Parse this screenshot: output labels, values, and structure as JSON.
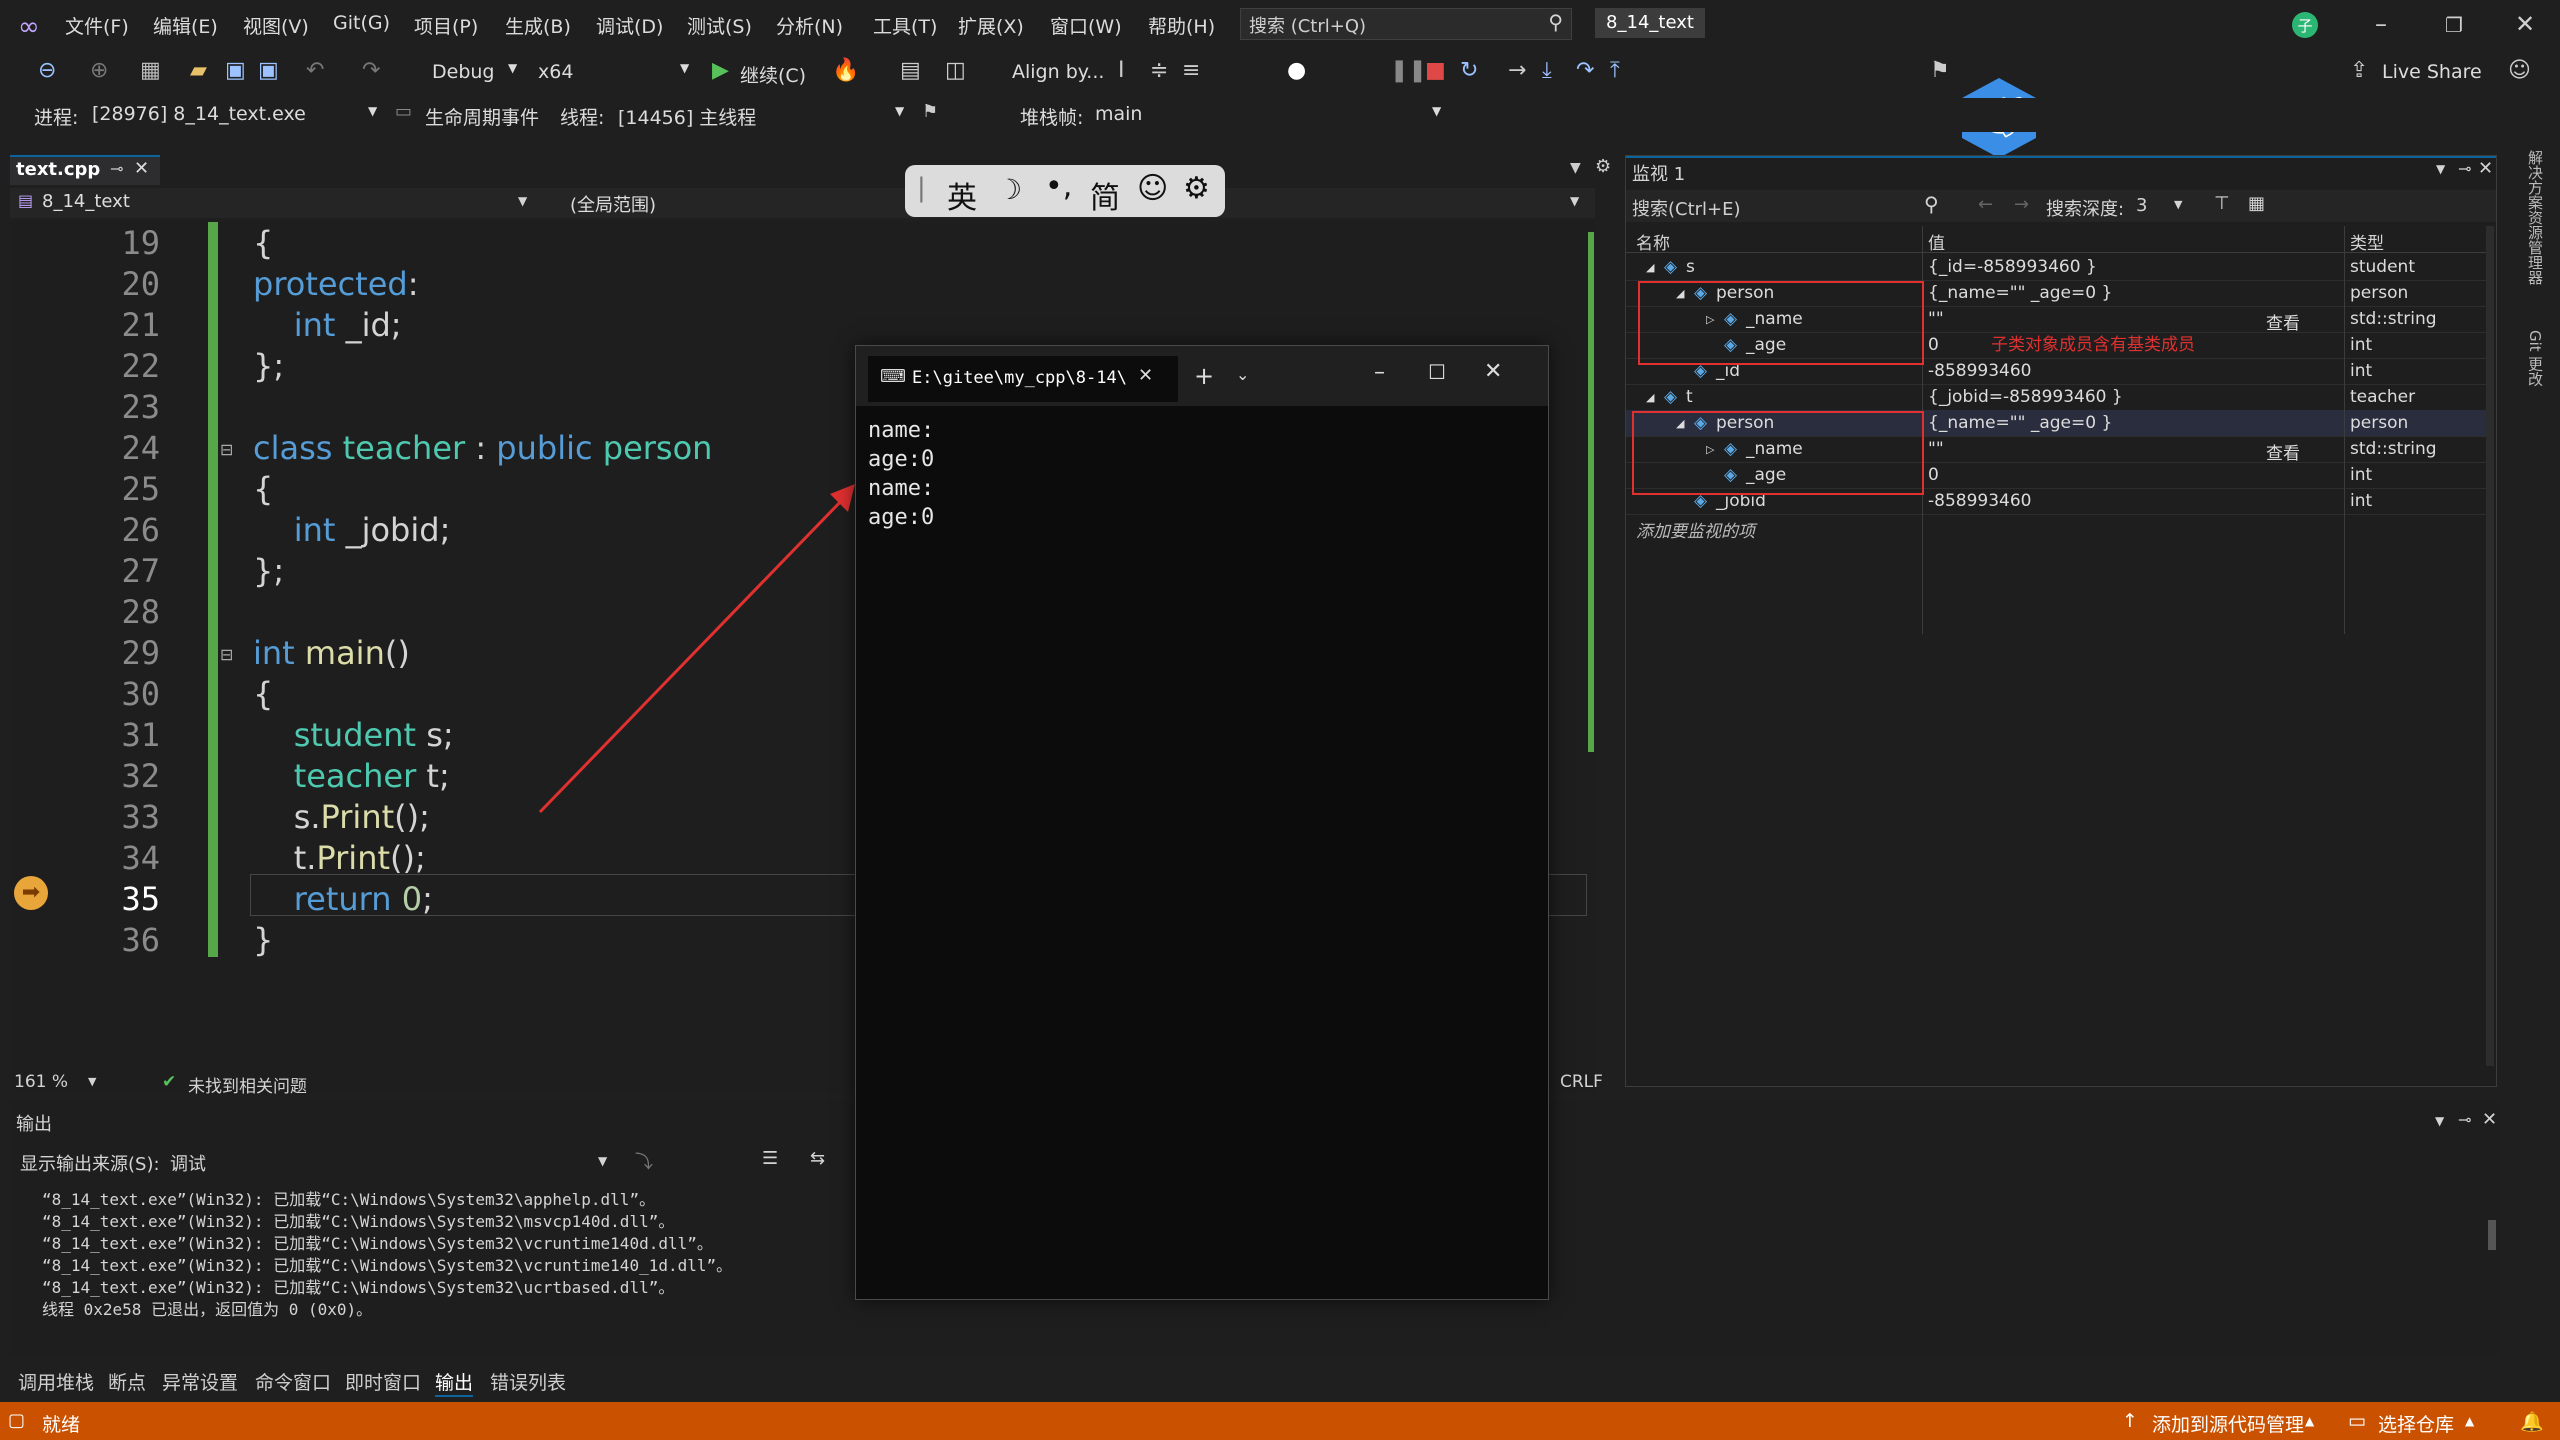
{
  "menu": {
    "items": [
      "文件(F)",
      "编辑(E)",
      "视图(V)",
      "Git(G)",
      "项目(P)",
      "生成(B)",
      "调试(D)",
      "测试(S)",
      "分析(N)",
      "工具(T)",
      "扩展(X)",
      "窗口(W)",
      "帮助(H)"
    ],
    "search_placeholder": "搜索 (Ctrl+Q)",
    "solution_name": "8_14_text",
    "user_initial": "子"
  },
  "toolbar": {
    "config": "Debug",
    "platform": "x64",
    "continue_label": "继续(C)",
    "align_label": "Align by...",
    "live_share": "Live Share",
    "process_label": "进程:",
    "process_value": "[28976] 8_14_text.exe",
    "lifecycle_label": "生命周期事件",
    "thread_label": "线程:",
    "thread_value": "[14456] 主线程",
    "stackframe_label": "堆栈帧:",
    "stackframe_value": "main"
  },
  "editor": {
    "tab_title": "text.cpp",
    "project_dropdown": "8_14_text",
    "scope_dropdown": "(全局范围)",
    "zoom": "161 %",
    "issues": "未找到相关问题",
    "line_ending": "CRLF",
    "current_line": "35",
    "line_numbers": [
      "19",
      "20",
      "21",
      "22",
      "23",
      "24",
      "25",
      "26",
      "27",
      "28",
      "29",
      "30",
      "31",
      "32",
      "33",
      "34",
      "35",
      "36"
    ]
  },
  "ime": {
    "lang": "英",
    "mode": "简"
  },
  "terminal": {
    "title": "E:\\gitee\\my_cpp\\8-14\\",
    "lines": [
      "name:",
      "age:0",
      "name:",
      "age:0"
    ]
  },
  "watch": {
    "title": "监视 1",
    "search_placeholder": "搜索(Ctrl+E)",
    "depth_label": "搜索深度:",
    "depth_value": "3",
    "headers": [
      "名称",
      "值",
      "类型"
    ],
    "add_item": "添加要监视的项",
    "annotation": "子类对象成员含有基类成员",
    "view_label": "查看",
    "rows": [
      {
        "name": "s",
        "value": "{_id=-858993460 }",
        "type": "student"
      },
      {
        "name": "person",
        "value": "{_name=\"\" _age=0 }",
        "type": "person"
      },
      {
        "name": "_name",
        "value": "\"\"",
        "type": "std::string"
      },
      {
        "name": "_age",
        "value": "0",
        "type": "int"
      },
      {
        "name": "_id",
        "value": "-858993460",
        "type": "int"
      },
      {
        "name": "t",
        "value": "{_jobid=-858993460 }",
        "type": "teacher"
      },
      {
        "name": "person",
        "value": "{_name=\"\" _age=0 }",
        "type": "person"
      },
      {
        "name": "_name",
        "value": "\"\"",
        "type": "std::string"
      },
      {
        "name": "_age",
        "value": "0",
        "type": "int"
      },
      {
        "name": "_jobid",
        "value": "-858993460",
        "type": "int"
      }
    ]
  },
  "output": {
    "title": "输出",
    "source_label": "显示输出来源(S):",
    "source_value": "调试",
    "lines": [
      "“8_14_text.exe”(Win32): 已加载“C:\\Windows\\System32\\apphelp.dll”。",
      "“8_14_text.exe”(Win32): 已加载“C:\\Windows\\System32\\msvcp140d.dll”。",
      "“8_14_text.exe”(Win32): 已加载“C:\\Windows\\System32\\vcruntime140d.dll”。",
      "“8_14_text.exe”(Win32): 已加载“C:\\Windows\\System32\\vcruntime140_1d.dll”。",
      "“8_14_text.exe”(Win32): 已加载“C:\\Windows\\System32\\ucrtbased.dll”。",
      "线程 0x2e58 已退出，返回值为 0 (0x0)。"
    ]
  },
  "bottom_tabs": [
    "调用堆栈",
    "断点",
    "异常设置",
    "命令窗口",
    "即时窗口",
    "输出",
    "错误列表"
  ],
  "status": {
    "ready": "就绪",
    "source_control": "添加到源代码管理",
    "repo": "选择仓库"
  },
  "side_tabs": [
    "解决方案资源管理器",
    "Git 更改"
  ],
  "colors": {
    "accent": "#0e639c",
    "status_bar": "#ca5100",
    "annotation_red": "#e03030",
    "git_green": "#57a64a"
  }
}
